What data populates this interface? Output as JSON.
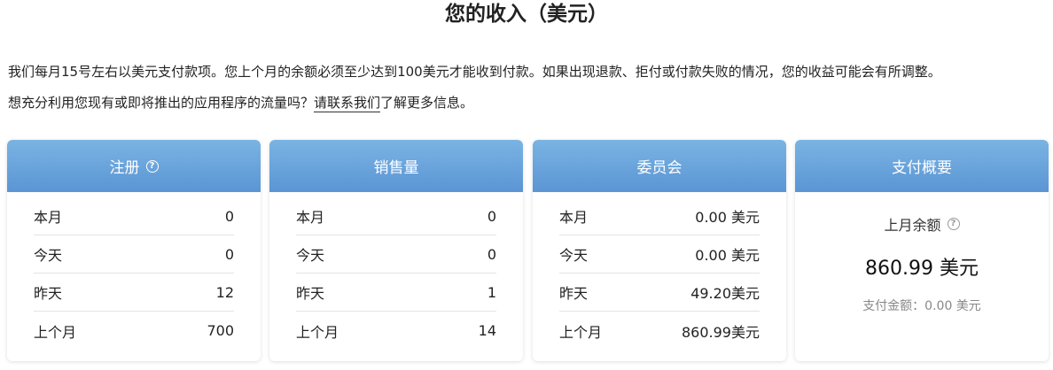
{
  "title": "您的收入（美元）",
  "intro": {
    "line1": "我们每月15号左右以美元支付款项。您上个月的余额必须至少达到100美元才能收到付款。如果出现退款、拒付或付款失败的情况，您的收益可能会有所调整。",
    "line2_prefix": "想充分利用您现有或即将推出的应用程序的流量吗？",
    "contact_link": "请联系我们",
    "line2_suffix": "了解更多信息。"
  },
  "help_glyph": "?",
  "cards": [
    {
      "title": "注册",
      "rows": [
        {
          "label": "本月",
          "value": "0"
        },
        {
          "label": "今天",
          "value": "0"
        },
        {
          "label": "昨天",
          "value": "12"
        },
        {
          "label": "上个月",
          "value": "700"
        }
      ]
    },
    {
      "title": "销售量",
      "rows": [
        {
          "label": "本月",
          "value": "0"
        },
        {
          "label": "今天",
          "value": "0"
        },
        {
          "label": "昨天",
          "value": "1"
        },
        {
          "label": "上个月",
          "value": "14"
        }
      ]
    },
    {
      "title": "委员会",
      "rows": [
        {
          "label": "本月",
          "value": "0.00 美元"
        },
        {
          "label": "今天",
          "value": "0.00 美元"
        },
        {
          "label": "昨天",
          "value": "49.20美元"
        },
        {
          "label": "上个月",
          "value": "860.99美元"
        }
      ]
    }
  ],
  "summary": {
    "title": "支付概要",
    "balance_label": "上月余额",
    "balance_value": "860.99 美元",
    "paid_text": "支付金额：0.00 美元"
  },
  "colors": {
    "header_top": "#7ab4e3",
    "header_bottom": "#5b95d4",
    "header_text": "#ffffff"
  }
}
